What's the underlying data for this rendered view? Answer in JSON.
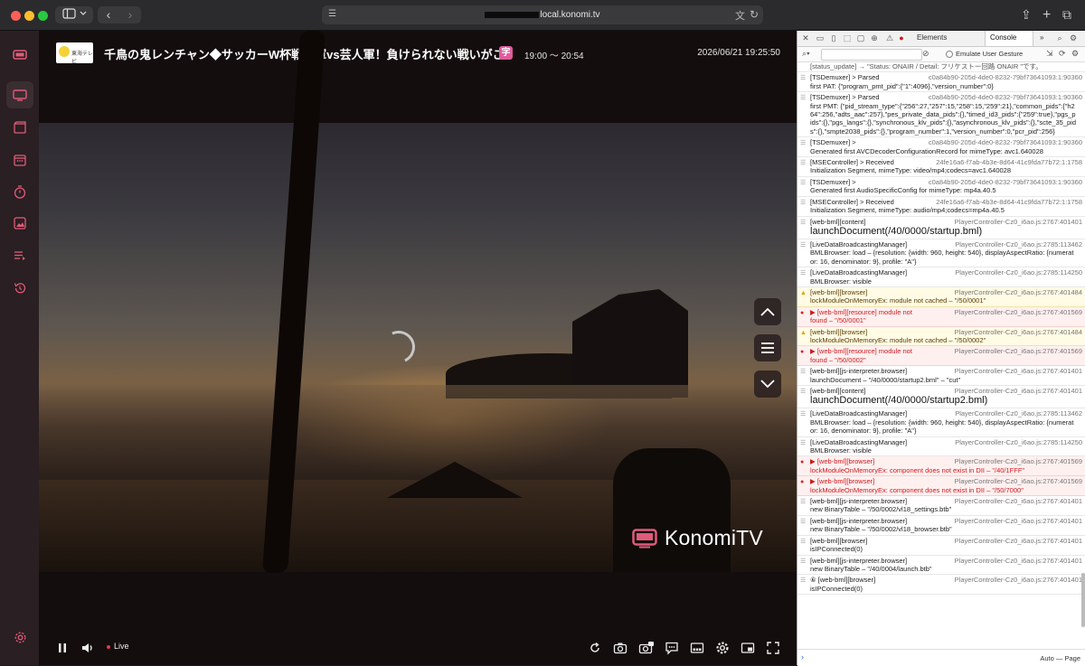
{
  "browser": {
    "url": "local.konomi.tv"
  },
  "player": {
    "channel_logo_text": "東海テレビ",
    "program_title": "千鳥の鬼レンチャン◆サッカーW杯戦士軍vs芸人軍！負けられない戦いがここにも...",
    "badge": "字",
    "program_time": "19:00 〜 20:54",
    "clock": "2026/06/21 19:25:50",
    "watermark": "KonomiTV",
    "live_label": "Live"
  },
  "devtools": {
    "tab_elements": "Elements",
    "tab_console": "Console",
    "more": "»",
    "emulate": "Emulate User Gesture",
    "context": "Auto — Page",
    "top_partial": "[status_update] → \"Status: ONAIR / Detail: フリケストー回路 ONAIR \"です。",
    "messages": [
      {
        "type": "log",
        "label": "[TSDemuxer] > Parsed",
        "src": "c0a84b90-205d-4de0-8232-79bf73641093:1:90360",
        "body": "first PAT: {\"program_pmt_pid\":{\"1\":4096},\"version_number\":0}"
      },
      {
        "type": "log",
        "label": "[TSDemuxer] > Parsed",
        "src": "c0a84b90-205d-4de0-8232-79bf73641093:1:90360",
        "body": "first PMT: {\"pid_stream_type\":{\"256\":27,\"257\":15,\"258\":15,\"259\":21},\"common_pids\":{\"h264\":256,\"adts_aac\":257},\"pes_private_data_pids\":{},\"timed_id3_pids\":{\"259\":true},\"pgs_pids\":{},\"pgs_langs\":{},\"synchronous_klv_pids\":{},\"asynchronous_klv_pids\":{},\"scte_35_pids\":{},\"smpte2038_pids\":{},\"program_number\":1,\"version_number\":0,\"pcr_pid\":256}"
      },
      {
        "type": "log",
        "label": "[TSDemuxer] >",
        "src": "c0a84b90-205d-4de0-8232-79bf73641093:1:90360",
        "body": "Generated first AVCDecoderConfigurationRecord for mimeType: avc1.640028"
      },
      {
        "type": "log",
        "label": "[MSEController] > Received",
        "src": "24fe16a6-f7ab-4b3e-8d64-41c9fda77b72:1:1758",
        "body": "Initialization Segment, mimeType: video/mp4;codecs=avc1.640028"
      },
      {
        "type": "log",
        "label": "[TSDemuxer] >",
        "src": "c0a84b90-205d-4de0-8232-79bf73641093:1:90360",
        "body": "Generated first AudioSpecificConfig for mimeType: mp4a.40.5"
      },
      {
        "type": "log",
        "label": "[MSEController] > Received",
        "src": "24fe16a6-f7ab-4b3e-8d64-41c9fda77b72:1:1758",
        "body": "Initialization Segment, mimeType: audio/mp4;codecs=mp4a.40.5"
      },
      {
        "type": "big",
        "label": "[web-bml][content]",
        "src": "PlayerController-Cz0_i6ao.js:2767:401401",
        "body": "launchDocument(/40/0000/startup.bml)"
      },
      {
        "type": "log",
        "label": "[LiveDataBroadcastingManager]",
        "src": "PlayerController-Cz0_i6ao.js:2785:113462",
        "body": "BMLBrowser: load – {resolution: {width: 960, height: 540}, displayAspectRatio: {numerator: 16, denominator: 9}, profile: \"A\"}"
      },
      {
        "type": "log",
        "label": "[LiveDataBroadcastingManager]",
        "src": "PlayerController-Cz0_i6ao.js:2785:114250",
        "body": "BMLBrowser: visible"
      },
      {
        "type": "warn",
        "label": "[web-bml][browser]",
        "src": "PlayerController-Cz0_i6ao.js:2767:401484",
        "body": "lockModuleOnMemoryEx: module not cached – \"/50/0001\""
      },
      {
        "type": "error",
        "label": "▶ [web-bml][resource] module not",
        "src": "PlayerController-Cz0_i6ao.js:2767:401569",
        "body": "found – \"/50/0001\""
      },
      {
        "type": "warn",
        "label": "[web-bml][browser]",
        "src": "PlayerController-Cz0_i6ao.js:2767:401484",
        "body": "lockModuleOnMemoryEx: module not cached – \"/50/0002\""
      },
      {
        "type": "error",
        "label": "▶ [web-bml][resource] module not",
        "src": "PlayerController-Cz0_i6ao.js:2767:401569",
        "body": "found – \"/50/0002\""
      },
      {
        "type": "log",
        "label": "[web-bml][js-interpreter.browser]",
        "src": "PlayerController-Cz0_i6ao.js:2767:401401",
        "body": "launchDocument – \"/40/0000/startup2.bml\" – \"cut\""
      },
      {
        "type": "big",
        "label": "[web-bml][content]",
        "src": "PlayerController-Cz0_i6ao.js:2767:401401",
        "body": "launchDocument(/40/0000/startup2.bml)"
      },
      {
        "type": "log",
        "label": "[LiveDataBroadcastingManager]",
        "src": "PlayerController-Cz0_i6ao.js:2785:113462",
        "body": "BMLBrowser: load – {resolution: {width: 960, height: 540}, displayAspectRatio: {numerator: 16, denominator: 9}, profile: \"A\"}"
      },
      {
        "type": "log",
        "label": "[LiveDataBroadcastingManager]",
        "src": "PlayerController-Cz0_i6ao.js:2785:114250",
        "body": "BMLBrowser: visible"
      },
      {
        "type": "error",
        "label": "▶ [web-bml][browser]",
        "src": "PlayerController-Cz0_i6ao.js:2767:401569",
        "body": "lockModuleOnMemoryEx: component does not exist in DII – \"/40/1FFF\""
      },
      {
        "type": "error",
        "label": "▶ [web-bml][browser]",
        "src": "PlayerController-Cz0_i6ao.js:2767:401569",
        "body": "lockModuleOnMemoryEx: component does not exist in DII – \"/50/7000\""
      },
      {
        "type": "log",
        "label": "[web-bml][js-interpreter.browser]",
        "src": "PlayerController-Cz0_i6ao.js:2767:401401",
        "body": "new BinaryTable – \"/50/0002/vl18_settings.btb\""
      },
      {
        "type": "log",
        "label": "[web-bml][js-interpreter.browser]",
        "src": "PlayerController-Cz0_i6ao.js:2767:401401",
        "body": "new BinaryTable – \"/50/0002/vl18_browser.btb\""
      },
      {
        "type": "log",
        "label": "[web-bml][browser]",
        "src": "PlayerController-Cz0_i6ao.js:2767:401401",
        "body": "isIPConnected(0)"
      },
      {
        "type": "log",
        "label": "[web-bml][js-interpreter.browser]",
        "src": "PlayerController-Cz0_i6ao.js:2767:401401",
        "body": "new BinaryTable – \"/40/0004/launch.btb\""
      },
      {
        "type": "log",
        "label": "⑥ [web-bml][browser]",
        "src": "PlayerController-Cz0_i6ao.js:2767:401401",
        "body": "isIPConnected(0)"
      }
    ]
  },
  "colors": {
    "accent": "#e05b9b",
    "live": "#e6394a",
    "konomi_brand": "#e05b7a"
  }
}
